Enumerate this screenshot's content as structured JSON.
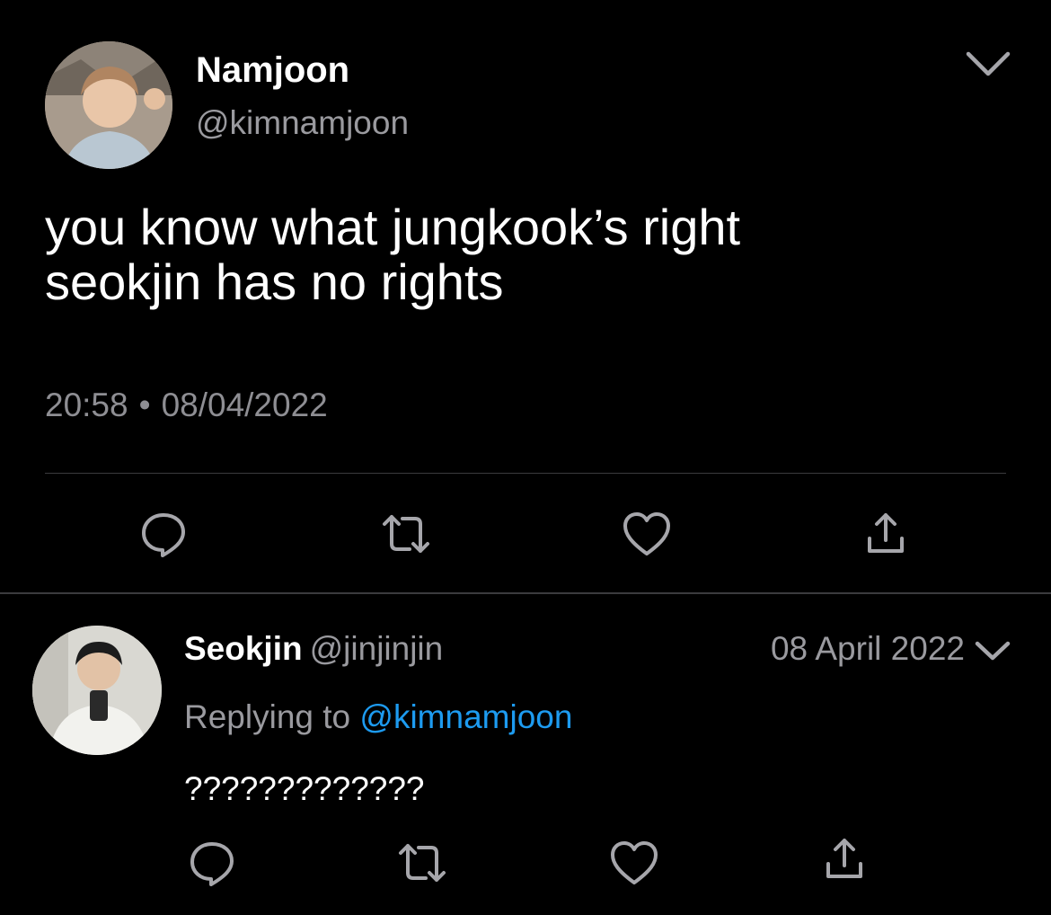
{
  "main_tweet": {
    "author_name": "Namjoon",
    "author_handle": "@kimnamjoon",
    "text_lines": [
      "you know what jungkook’s right",
      "seokjin has no rights"
    ],
    "time": "20:58",
    "separator": "•",
    "date": "08/04/2022",
    "menu_icon": "chevron-down-icon",
    "actions": [
      "reply-icon",
      "retweet-icon",
      "like-icon",
      "share-icon"
    ]
  },
  "reply_tweet": {
    "author_name": "Seokjin",
    "author_handle": "@jinjinjin",
    "date": "08 April 2022",
    "replying_prefix": "Replying to",
    "replying_to": "@kimnamjoon",
    "text": "?????????????",
    "menu_icon": "chevron-down-icon",
    "actions": [
      "reply-icon",
      "retweet-icon",
      "like-icon",
      "share-icon"
    ]
  },
  "colors": {
    "background": "#000000",
    "primary_text": "#ffffff",
    "secondary_text": "#9a9a9f",
    "link": "#1d9bf0",
    "divider": "#3b3b3e",
    "icon": "#a6a6ab"
  }
}
